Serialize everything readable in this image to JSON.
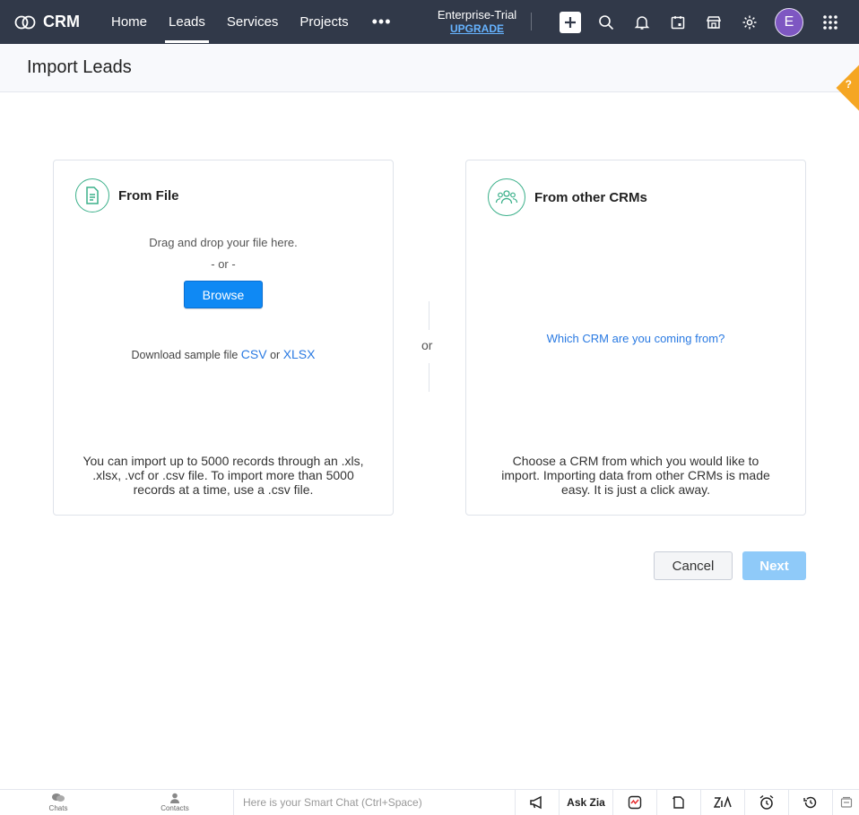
{
  "topbar": {
    "brand": "CRM",
    "tabs": [
      {
        "label": "Home"
      },
      {
        "label": "Leads"
      },
      {
        "label": "Services"
      },
      {
        "label": "Projects"
      },
      {
        "label": "•••"
      }
    ],
    "plan": "Enterprise-Trial",
    "upgrade": "UPGRADE",
    "avatar_letter": "E",
    "colors": {
      "bar": "#313949",
      "avatar": "#7e57c2",
      "upgrade": "#66b3ff"
    }
  },
  "page": {
    "title": "Import Leads"
  },
  "from_file": {
    "title": "From File",
    "drag_text": "Drag and drop your file here.",
    "or_text": "- or -",
    "browse_label": "Browse",
    "sample_prefix": "Download sample file",
    "csv_link": "CSV",
    "or_word": "or",
    "xlsx_link": "XLSX",
    "footer": "You can import up to 5000 records through an .xls, .xlsx, .vcf or .csv file. To import more than 5000 records at a time, use a .csv file."
  },
  "separator": {
    "or": "or"
  },
  "from_crm": {
    "title": "From other CRMs",
    "link": "Which CRM are you coming from?",
    "footer": "Choose a CRM from which you would like to import. Importing data from other CRMs is made easy. It is just a click away."
  },
  "actions": {
    "cancel": "Cancel",
    "next": "Next"
  },
  "bottombar": {
    "chats": "Chats",
    "contacts": "Contacts",
    "smart_chat_placeholder": "Here is your Smart Chat (Ctrl+Space)",
    "ask_zia": "Ask Zia"
  },
  "help": {
    "label": "?"
  }
}
